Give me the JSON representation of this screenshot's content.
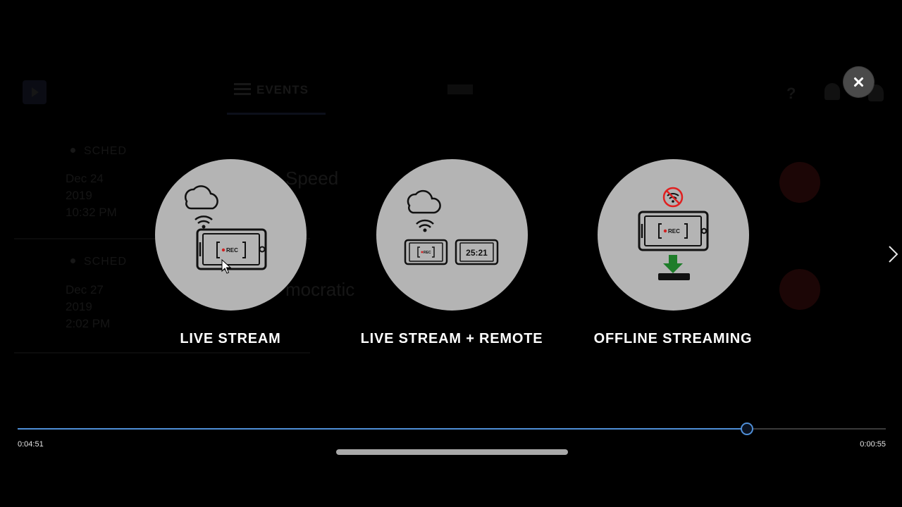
{
  "background": {
    "nav_events_label": "EVENTS",
    "help_symbol": "?",
    "rows": [
      {
        "status": "SCHED",
        "date_lines": [
          "Dec 24",
          "2019",
          "10:32 PM"
        ],
        "title_fragment": "Speed"
      },
      {
        "status": "SCHED",
        "date_lines": [
          "Dec 27",
          "2019",
          "2:02 PM"
        ],
        "title_fragment": "mocratic"
      }
    ]
  },
  "options": [
    {
      "label": "LIVE STREAM",
      "icon": "cloud-wifi-phone-rec-icon"
    },
    {
      "label": "LIVE STREAM + REMOTE",
      "icon": "cloud-wifi-dual-phone-icon",
      "remote_timer": "25:21"
    },
    {
      "label": "OFFLINE STREAMING",
      "icon": "no-wifi-phone-download-icon"
    }
  ],
  "rec_badge": "REC",
  "playback": {
    "elapsed": "0:04:51",
    "remaining": "0:00:55",
    "progress_fraction": 0.84
  },
  "colors": {
    "accent": "#4f8fd8",
    "circle": "#b4b4b4",
    "download_arrow": "#1e7d2a",
    "no_wifi": "#e02020"
  }
}
